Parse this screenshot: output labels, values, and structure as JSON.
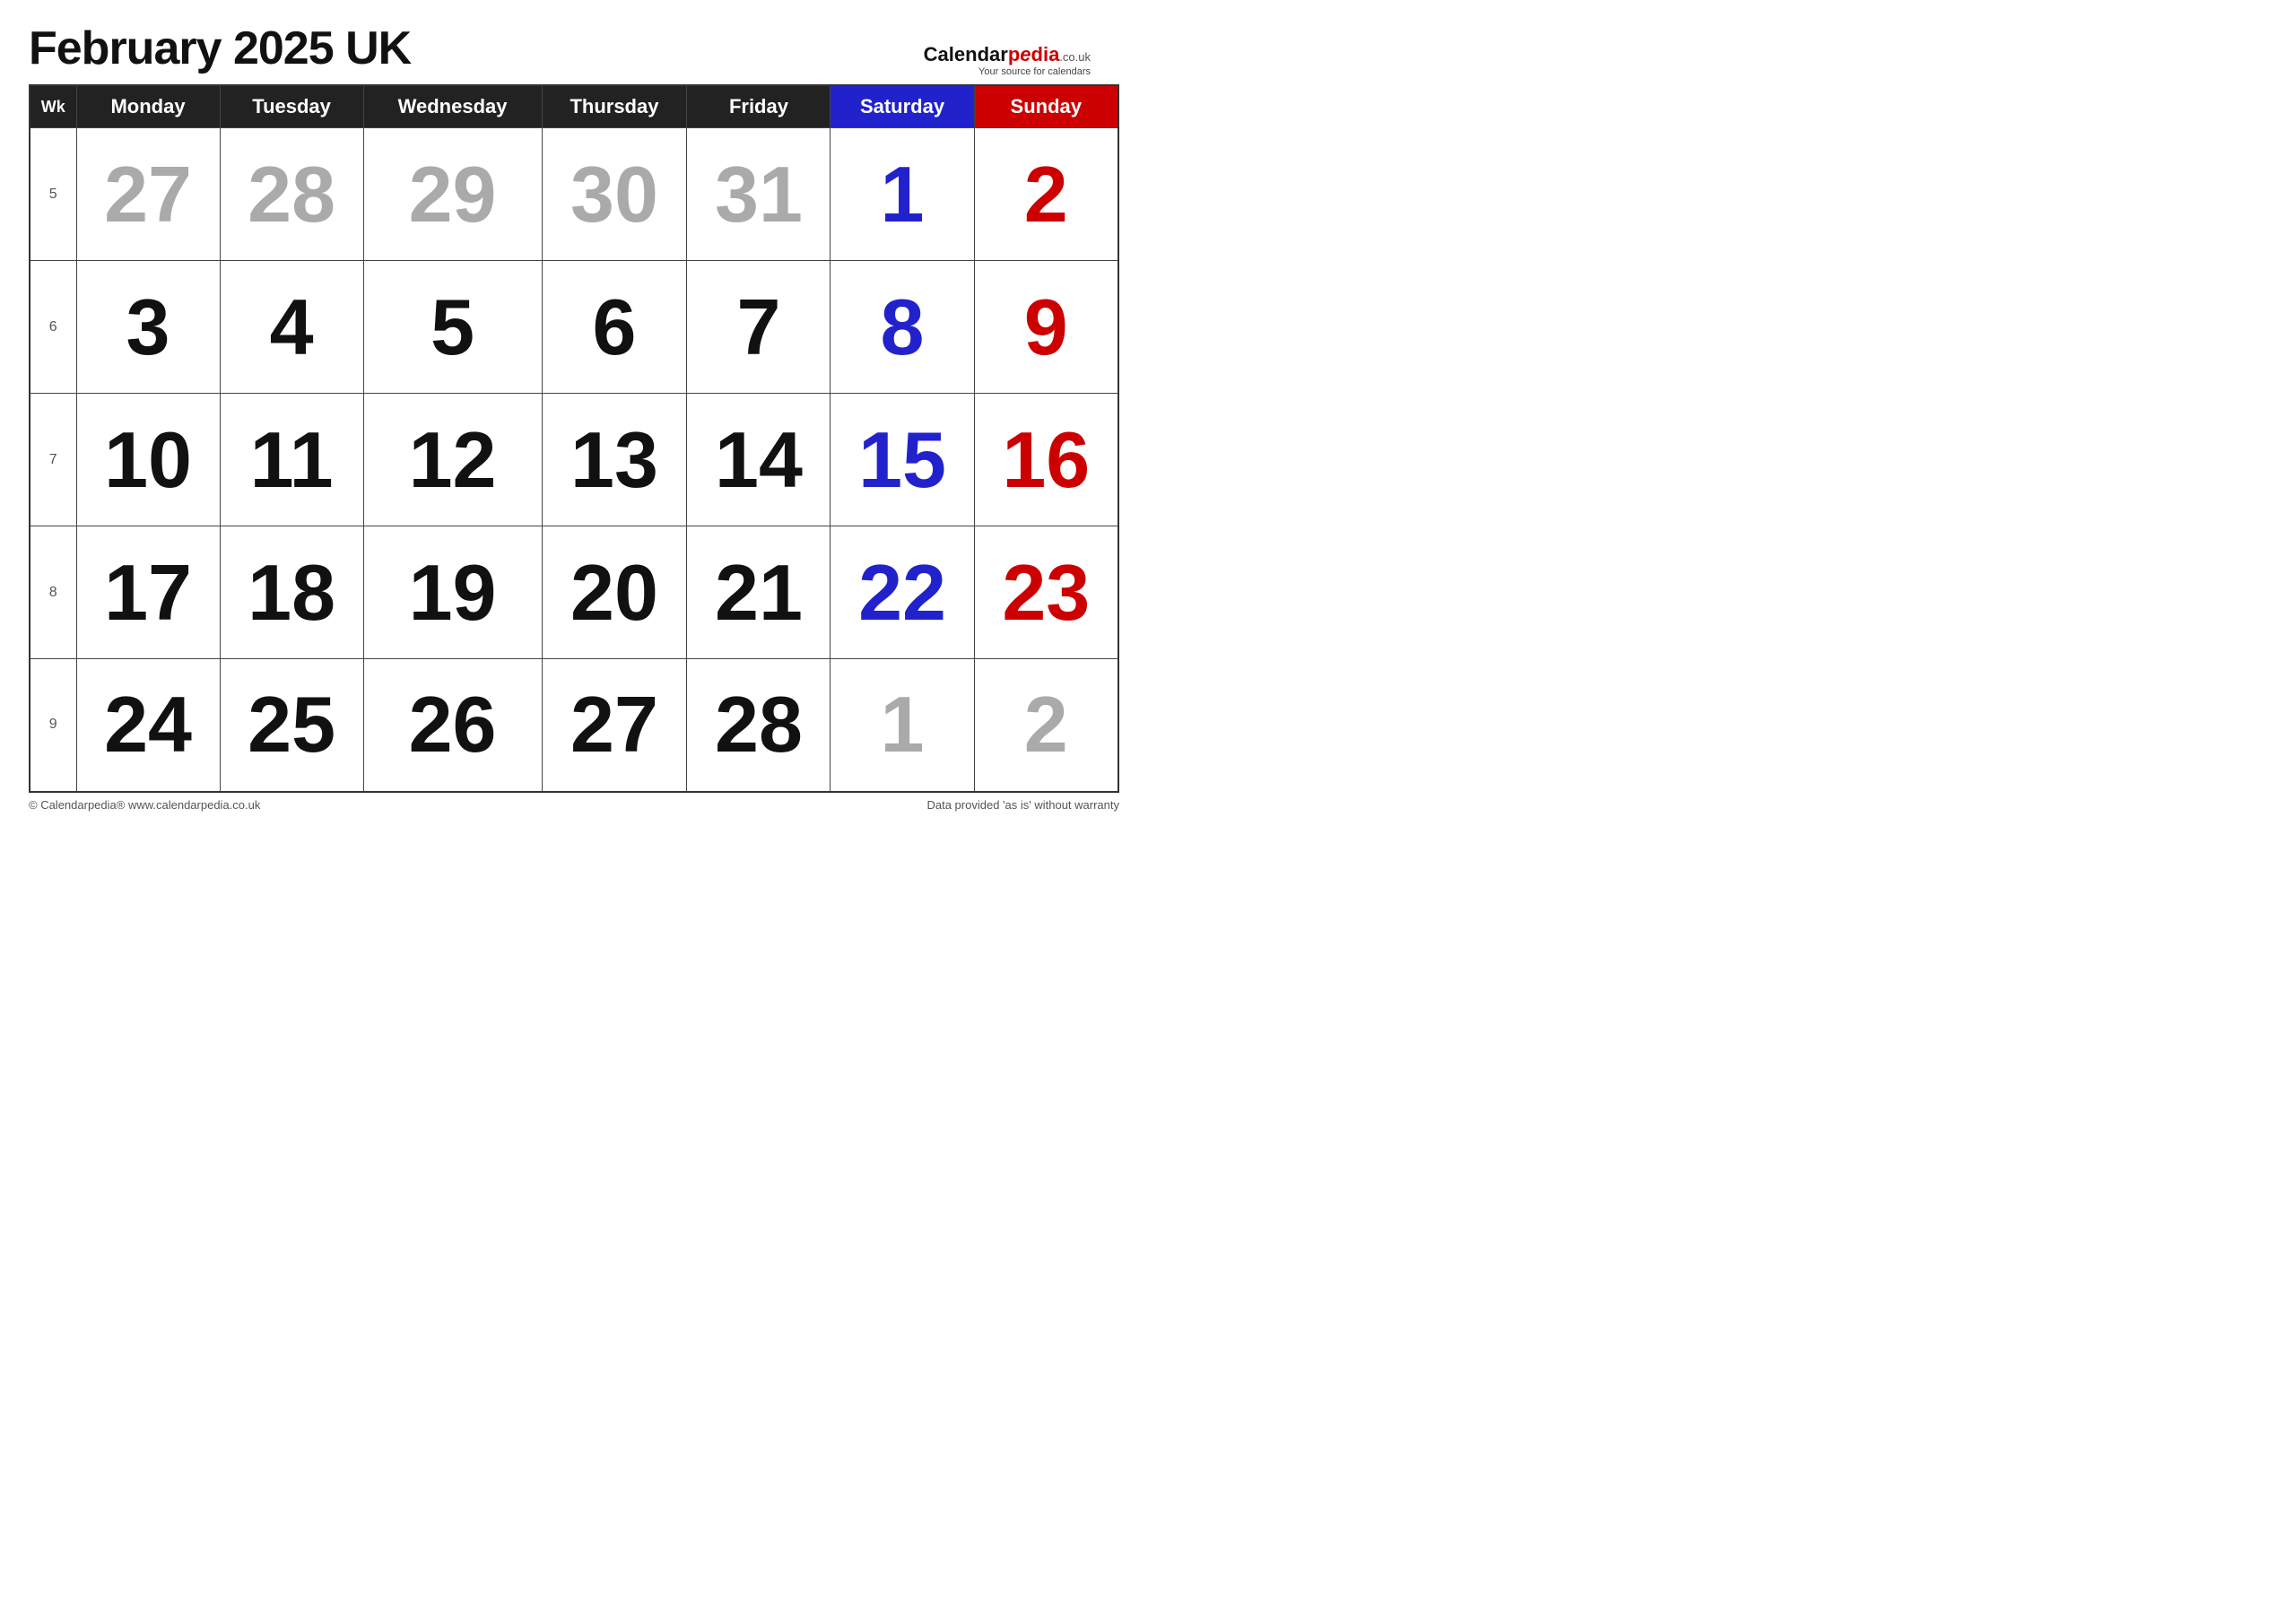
{
  "title": "February 2025 UK",
  "logo": {
    "main": "Calendarpedia",
    "domain": ".co.uk",
    "sub": "Your source for calendars"
  },
  "headers": {
    "wk": "Wk",
    "mon": "Monday",
    "tue": "Tuesday",
    "wed": "Wednesday",
    "thu": "Thursday",
    "fri": "Friday",
    "sat": "Saturday",
    "sun": "Sunday"
  },
  "weeks": [
    {
      "wk": "5",
      "days": [
        {
          "num": "27",
          "color": "gray"
        },
        {
          "num": "28",
          "color": "gray"
        },
        {
          "num": "29",
          "color": "gray"
        },
        {
          "num": "30",
          "color": "gray"
        },
        {
          "num": "31",
          "color": "gray"
        },
        {
          "num": "1",
          "color": "blue"
        },
        {
          "num": "2",
          "color": "red"
        }
      ]
    },
    {
      "wk": "6",
      "days": [
        {
          "num": "3",
          "color": "black"
        },
        {
          "num": "4",
          "color": "black"
        },
        {
          "num": "5",
          "color": "black"
        },
        {
          "num": "6",
          "color": "black"
        },
        {
          "num": "7",
          "color": "black"
        },
        {
          "num": "8",
          "color": "blue"
        },
        {
          "num": "9",
          "color": "red"
        }
      ]
    },
    {
      "wk": "7",
      "days": [
        {
          "num": "10",
          "color": "black"
        },
        {
          "num": "11",
          "color": "black"
        },
        {
          "num": "12",
          "color": "black"
        },
        {
          "num": "13",
          "color": "black"
        },
        {
          "num": "14",
          "color": "black"
        },
        {
          "num": "15",
          "color": "blue"
        },
        {
          "num": "16",
          "color": "red"
        }
      ]
    },
    {
      "wk": "8",
      "days": [
        {
          "num": "17",
          "color": "black"
        },
        {
          "num": "18",
          "color": "black"
        },
        {
          "num": "19",
          "color": "black"
        },
        {
          "num": "20",
          "color": "black"
        },
        {
          "num": "21",
          "color": "black"
        },
        {
          "num": "22",
          "color": "blue"
        },
        {
          "num": "23",
          "color": "red"
        }
      ]
    },
    {
      "wk": "9",
      "days": [
        {
          "num": "24",
          "color": "black"
        },
        {
          "num": "25",
          "color": "black"
        },
        {
          "num": "26",
          "color": "black"
        },
        {
          "num": "27",
          "color": "black"
        },
        {
          "num": "28",
          "color": "black"
        },
        {
          "num": "1",
          "color": "gray"
        },
        {
          "num": "2",
          "color": "gray"
        }
      ]
    }
  ],
  "footer": {
    "left": "© Calendarpedia®  www.calendarpedia.co.uk",
    "right": "Data provided 'as is' without warranty"
  }
}
